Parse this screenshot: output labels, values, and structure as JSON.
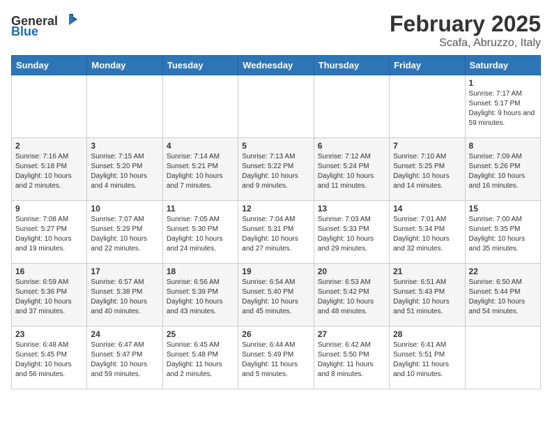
{
  "header": {
    "logo_general": "General",
    "logo_blue": "Blue",
    "month_title": "February 2025",
    "location": "Scafa, Abruzzo, Italy"
  },
  "days_of_week": [
    "Sunday",
    "Monday",
    "Tuesday",
    "Wednesday",
    "Thursday",
    "Friday",
    "Saturday"
  ],
  "weeks": [
    [
      {
        "day": "",
        "info": ""
      },
      {
        "day": "",
        "info": ""
      },
      {
        "day": "",
        "info": ""
      },
      {
        "day": "",
        "info": ""
      },
      {
        "day": "",
        "info": ""
      },
      {
        "day": "",
        "info": ""
      },
      {
        "day": "1",
        "info": "Sunrise: 7:17 AM\nSunset: 5:17 PM\nDaylight: 9 hours and 59 minutes."
      }
    ],
    [
      {
        "day": "2",
        "info": "Sunrise: 7:16 AM\nSunset: 5:18 PM\nDaylight: 10 hours and 2 minutes."
      },
      {
        "day": "3",
        "info": "Sunrise: 7:15 AM\nSunset: 5:20 PM\nDaylight: 10 hours and 4 minutes."
      },
      {
        "day": "4",
        "info": "Sunrise: 7:14 AM\nSunset: 5:21 PM\nDaylight: 10 hours and 7 minutes."
      },
      {
        "day": "5",
        "info": "Sunrise: 7:13 AM\nSunset: 5:22 PM\nDaylight: 10 hours and 9 minutes."
      },
      {
        "day": "6",
        "info": "Sunrise: 7:12 AM\nSunset: 5:24 PM\nDaylight: 10 hours and 11 minutes."
      },
      {
        "day": "7",
        "info": "Sunrise: 7:10 AM\nSunset: 5:25 PM\nDaylight: 10 hours and 14 minutes."
      },
      {
        "day": "8",
        "info": "Sunrise: 7:09 AM\nSunset: 5:26 PM\nDaylight: 10 hours and 16 minutes."
      }
    ],
    [
      {
        "day": "9",
        "info": "Sunrise: 7:08 AM\nSunset: 5:27 PM\nDaylight: 10 hours and 19 minutes."
      },
      {
        "day": "10",
        "info": "Sunrise: 7:07 AM\nSunset: 5:29 PM\nDaylight: 10 hours and 22 minutes."
      },
      {
        "day": "11",
        "info": "Sunrise: 7:05 AM\nSunset: 5:30 PM\nDaylight: 10 hours and 24 minutes."
      },
      {
        "day": "12",
        "info": "Sunrise: 7:04 AM\nSunset: 5:31 PM\nDaylight: 10 hours and 27 minutes."
      },
      {
        "day": "13",
        "info": "Sunrise: 7:03 AM\nSunset: 5:33 PM\nDaylight: 10 hours and 29 minutes."
      },
      {
        "day": "14",
        "info": "Sunrise: 7:01 AM\nSunset: 5:34 PM\nDaylight: 10 hours and 32 minutes."
      },
      {
        "day": "15",
        "info": "Sunrise: 7:00 AM\nSunset: 5:35 PM\nDaylight: 10 hours and 35 minutes."
      }
    ],
    [
      {
        "day": "16",
        "info": "Sunrise: 6:59 AM\nSunset: 5:36 PM\nDaylight: 10 hours and 37 minutes."
      },
      {
        "day": "17",
        "info": "Sunrise: 6:57 AM\nSunset: 5:38 PM\nDaylight: 10 hours and 40 minutes."
      },
      {
        "day": "18",
        "info": "Sunrise: 6:56 AM\nSunset: 5:39 PM\nDaylight: 10 hours and 43 minutes."
      },
      {
        "day": "19",
        "info": "Sunrise: 6:54 AM\nSunset: 5:40 PM\nDaylight: 10 hours and 45 minutes."
      },
      {
        "day": "20",
        "info": "Sunrise: 6:53 AM\nSunset: 5:42 PM\nDaylight: 10 hours and 48 minutes."
      },
      {
        "day": "21",
        "info": "Sunrise: 6:51 AM\nSunset: 5:43 PM\nDaylight: 10 hours and 51 minutes."
      },
      {
        "day": "22",
        "info": "Sunrise: 6:50 AM\nSunset: 5:44 PM\nDaylight: 10 hours and 54 minutes."
      }
    ],
    [
      {
        "day": "23",
        "info": "Sunrise: 6:48 AM\nSunset: 5:45 PM\nDaylight: 10 hours and 56 minutes."
      },
      {
        "day": "24",
        "info": "Sunrise: 6:47 AM\nSunset: 5:47 PM\nDaylight: 10 hours and 59 minutes."
      },
      {
        "day": "25",
        "info": "Sunrise: 6:45 AM\nSunset: 5:48 PM\nDaylight: 11 hours and 2 minutes."
      },
      {
        "day": "26",
        "info": "Sunrise: 6:44 AM\nSunset: 5:49 PM\nDaylight: 11 hours and 5 minutes."
      },
      {
        "day": "27",
        "info": "Sunrise: 6:42 AM\nSunset: 5:50 PM\nDaylight: 11 hours and 8 minutes."
      },
      {
        "day": "28",
        "info": "Sunrise: 6:41 AM\nSunset: 5:51 PM\nDaylight: 11 hours and 10 minutes."
      },
      {
        "day": "",
        "info": ""
      }
    ]
  ]
}
